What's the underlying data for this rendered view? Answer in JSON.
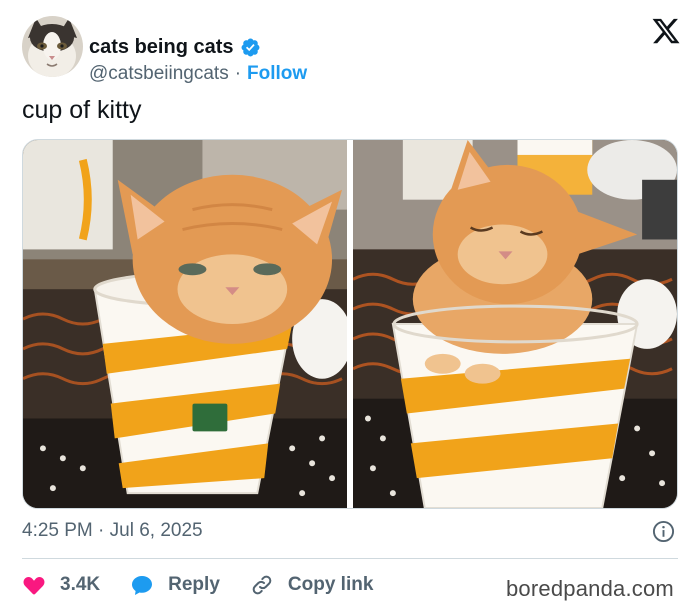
{
  "author": {
    "display_name": "cats being cats",
    "handle": "@catsbeiingcats",
    "separator": "·",
    "follow_label": "Follow"
  },
  "tweet": {
    "text": "cup of kitty",
    "timestamp": "4:25 PM · Jul 6, 2025"
  },
  "actions": {
    "like_count": "3.4K",
    "reply_label": "Reply",
    "copy_link_label": "Copy link"
  },
  "watermark": "boredpanda.com",
  "colors": {
    "accent": "#1d9bf0",
    "like": "#f91880",
    "text_primary": "#0f1419",
    "text_secondary": "#536471"
  },
  "icons": [
    "avatar-cat",
    "verified-badge-icon",
    "x-logo-icon",
    "info-icon",
    "heart-icon",
    "reply-bubble-icon",
    "link-icon"
  ]
}
